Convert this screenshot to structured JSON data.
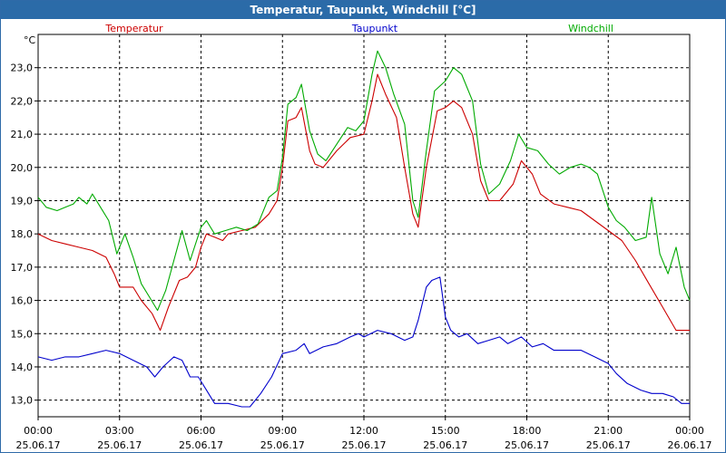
{
  "window": {
    "title": "Temperatur, Taupunkt, Windchill [°C]"
  },
  "chart_data": {
    "type": "line",
    "title": "Temperatur, Taupunkt, Windchill [°C]",
    "ylabel": "°C",
    "ylim": [
      12.5,
      24.0
    ],
    "xlim": [
      0,
      24
    ],
    "y_ticks": [
      "13,0",
      "14,0",
      "15,0",
      "16,0",
      "17,0",
      "18,0",
      "19,0",
      "20,0",
      "21,0",
      "22,0",
      "23,0"
    ],
    "y_tick_values": [
      13,
      14,
      15,
      16,
      17,
      18,
      19,
      20,
      21,
      22,
      23
    ],
    "x_ticks": [
      {
        "time": "00:00",
        "date": "25.06.17",
        "h": 0
      },
      {
        "time": "03:00",
        "date": "25.06.17",
        "h": 3
      },
      {
        "time": "06:00",
        "date": "25.06.17",
        "h": 6
      },
      {
        "time": "09:00",
        "date": "25.06.17",
        "h": 9
      },
      {
        "time": "12:00",
        "date": "25.06.17",
        "h": 12
      },
      {
        "time": "15:00",
        "date": "25.06.17",
        "h": 15
      },
      {
        "time": "18:00",
        "date": "25.06.17",
        "h": 18
      },
      {
        "time": "21:00",
        "date": "25.06.17",
        "h": 21
      },
      {
        "time": "00:00",
        "date": "26.06.17",
        "h": 24
      }
    ],
    "grid": true,
    "grid_style": "dashed",
    "series": [
      {
        "name": "Temperatur",
        "color": "#cc0000",
        "legend_position": "left",
        "points": [
          [
            0,
            18.0
          ],
          [
            0.5,
            17.8
          ],
          [
            1,
            17.7
          ],
          [
            1.5,
            17.6
          ],
          [
            2,
            17.5
          ],
          [
            2.5,
            17.3
          ],
          [
            2.8,
            16.8
          ],
          [
            3,
            16.4
          ],
          [
            3.5,
            16.4
          ],
          [
            3.8,
            16.0
          ],
          [
            4.2,
            15.6
          ],
          [
            4.5,
            15.1
          ],
          [
            4.8,
            15.8
          ],
          [
            5.2,
            16.6
          ],
          [
            5.5,
            16.7
          ],
          [
            5.8,
            17.0
          ],
          [
            6.0,
            17.6
          ],
          [
            6.2,
            18.0
          ],
          [
            6.5,
            17.9
          ],
          [
            6.8,
            17.8
          ],
          [
            7,
            18.0
          ],
          [
            7.5,
            18.1
          ],
          [
            8,
            18.2
          ],
          [
            8.5,
            18.6
          ],
          [
            8.8,
            19.0
          ],
          [
            9.0,
            20.0
          ],
          [
            9.2,
            21.4
          ],
          [
            9.5,
            21.5
          ],
          [
            9.7,
            21.8
          ],
          [
            10.0,
            20.5
          ],
          [
            10.2,
            20.1
          ],
          [
            10.5,
            20.0
          ],
          [
            11,
            20.5
          ],
          [
            11.5,
            20.9
          ],
          [
            12,
            21.0
          ],
          [
            12.3,
            22.0
          ],
          [
            12.5,
            22.8
          ],
          [
            12.8,
            22.2
          ],
          [
            13.2,
            21.5
          ],
          [
            13.5,
            20.0
          ],
          [
            13.8,
            18.6
          ],
          [
            14.0,
            18.2
          ],
          [
            14.3,
            20.0
          ],
          [
            14.7,
            21.7
          ],
          [
            15.0,
            21.8
          ],
          [
            15.3,
            22.0
          ],
          [
            15.6,
            21.8
          ],
          [
            16.0,
            21.0
          ],
          [
            16.3,
            19.6
          ],
          [
            16.6,
            19.0
          ],
          [
            17.0,
            19.0
          ],
          [
            17.5,
            19.5
          ],
          [
            17.8,
            20.2
          ],
          [
            18.2,
            19.8
          ],
          [
            18.5,
            19.2
          ],
          [
            19,
            18.9
          ],
          [
            19.5,
            18.8
          ],
          [
            20,
            18.7
          ],
          [
            20.5,
            18.4
          ],
          [
            21,
            18.1
          ],
          [
            21.5,
            17.8
          ],
          [
            22,
            17.2
          ],
          [
            22.5,
            16.5
          ],
          [
            23,
            15.8
          ],
          [
            23.5,
            15.1
          ],
          [
            24,
            15.1
          ]
        ]
      },
      {
        "name": "Taupunkt",
        "color": "#0000cc",
        "legend_position": "center",
        "points": [
          [
            0,
            14.3
          ],
          [
            0.5,
            14.2
          ],
          [
            1,
            14.3
          ],
          [
            1.5,
            14.3
          ],
          [
            2,
            14.4
          ],
          [
            2.5,
            14.5
          ],
          [
            3,
            14.4
          ],
          [
            3.5,
            14.2
          ],
          [
            4,
            14.0
          ],
          [
            4.3,
            13.7
          ],
          [
            4.6,
            14.0
          ],
          [
            5,
            14.3
          ],
          [
            5.3,
            14.2
          ],
          [
            5.6,
            13.7
          ],
          [
            5.9,
            13.7
          ],
          [
            6.2,
            13.3
          ],
          [
            6.5,
            12.9
          ],
          [
            7,
            12.9
          ],
          [
            7.5,
            12.8
          ],
          [
            7.8,
            12.8
          ],
          [
            8.2,
            13.2
          ],
          [
            8.6,
            13.7
          ],
          [
            9.0,
            14.4
          ],
          [
            9.5,
            14.5
          ],
          [
            9.8,
            14.7
          ],
          [
            10,
            14.4
          ],
          [
            10.5,
            14.6
          ],
          [
            11,
            14.7
          ],
          [
            11.5,
            14.9
          ],
          [
            11.8,
            15.0
          ],
          [
            12,
            14.9
          ],
          [
            12.5,
            15.1
          ],
          [
            13,
            15.0
          ],
          [
            13.5,
            14.8
          ],
          [
            13.8,
            14.9
          ],
          [
            14.0,
            15.4
          ],
          [
            14.3,
            16.4
          ],
          [
            14.5,
            16.6
          ],
          [
            14.8,
            16.7
          ],
          [
            15.0,
            15.5
          ],
          [
            15.2,
            15.1
          ],
          [
            15.5,
            14.9
          ],
          [
            15.8,
            15.0
          ],
          [
            16.2,
            14.7
          ],
          [
            16.6,
            14.8
          ],
          [
            17,
            14.9
          ],
          [
            17.3,
            14.7
          ],
          [
            17.8,
            14.9
          ],
          [
            18.2,
            14.6
          ],
          [
            18.6,
            14.7
          ],
          [
            19,
            14.5
          ],
          [
            19.5,
            14.5
          ],
          [
            20,
            14.5
          ],
          [
            20.5,
            14.3
          ],
          [
            21,
            14.1
          ],
          [
            21.3,
            13.8
          ],
          [
            21.7,
            13.5
          ],
          [
            22.2,
            13.3
          ],
          [
            22.6,
            13.2
          ],
          [
            23,
            13.2
          ],
          [
            23.4,
            13.1
          ],
          [
            23.7,
            12.9
          ],
          [
            24,
            12.9
          ]
        ]
      },
      {
        "name": "Windchill",
        "color": "#00aa00",
        "legend_position": "right",
        "points": [
          [
            0,
            19.1
          ],
          [
            0.3,
            18.8
          ],
          [
            0.7,
            18.7
          ],
          [
            1,
            18.8
          ],
          [
            1.3,
            18.9
          ],
          [
            1.5,
            19.1
          ],
          [
            1.8,
            18.9
          ],
          [
            2,
            19.2
          ],
          [
            2.3,
            18.8
          ],
          [
            2.6,
            18.4
          ],
          [
            2.9,
            17.4
          ],
          [
            3.2,
            18.0
          ],
          [
            3.5,
            17.3
          ],
          [
            3.8,
            16.5
          ],
          [
            4.1,
            16.1
          ],
          [
            4.4,
            15.7
          ],
          [
            4.7,
            16.3
          ],
          [
            5.0,
            17.2
          ],
          [
            5.3,
            18.1
          ],
          [
            5.6,
            17.2
          ],
          [
            6.0,
            18.2
          ],
          [
            6.2,
            18.4
          ],
          [
            6.5,
            18.0
          ],
          [
            6.9,
            18.1
          ],
          [
            7.3,
            18.2
          ],
          [
            7.7,
            18.1
          ],
          [
            8.1,
            18.3
          ],
          [
            8.5,
            19.1
          ],
          [
            8.8,
            19.3
          ],
          [
            9.0,
            20.3
          ],
          [
            9.2,
            21.9
          ],
          [
            9.5,
            22.1
          ],
          [
            9.7,
            22.5
          ],
          [
            10.0,
            21.1
          ],
          [
            10.3,
            20.4
          ],
          [
            10.6,
            20.2
          ],
          [
            11.0,
            20.7
          ],
          [
            11.4,
            21.2
          ],
          [
            11.7,
            21.1
          ],
          [
            12.0,
            21.4
          ],
          [
            12.3,
            22.8
          ],
          [
            12.5,
            23.5
          ],
          [
            12.8,
            23.0
          ],
          [
            13.1,
            22.2
          ],
          [
            13.5,
            21.3
          ],
          [
            13.8,
            19.0
          ],
          [
            14.0,
            18.5
          ],
          [
            14.3,
            20.5
          ],
          [
            14.6,
            22.3
          ],
          [
            15.0,
            22.6
          ],
          [
            15.3,
            23.0
          ],
          [
            15.6,
            22.8
          ],
          [
            16.0,
            22.0
          ],
          [
            16.3,
            20.1
          ],
          [
            16.6,
            19.2
          ],
          [
            17.0,
            19.5
          ],
          [
            17.4,
            20.2
          ],
          [
            17.7,
            21.0
          ],
          [
            18.0,
            20.6
          ],
          [
            18.4,
            20.5
          ],
          [
            18.8,
            20.1
          ],
          [
            19.2,
            19.8
          ],
          [
            19.6,
            20.0
          ],
          [
            20.0,
            20.1
          ],
          [
            20.3,
            20.0
          ],
          [
            20.6,
            19.8
          ],
          [
            21.0,
            18.8
          ],
          [
            21.3,
            18.4
          ],
          [
            21.6,
            18.2
          ],
          [
            22.0,
            17.8
          ],
          [
            22.4,
            17.9
          ],
          [
            22.6,
            19.1
          ],
          [
            22.9,
            17.4
          ],
          [
            23.2,
            16.8
          ],
          [
            23.5,
            17.6
          ],
          [
            23.8,
            16.4
          ],
          [
            24,
            16.0
          ]
        ]
      }
    ]
  }
}
